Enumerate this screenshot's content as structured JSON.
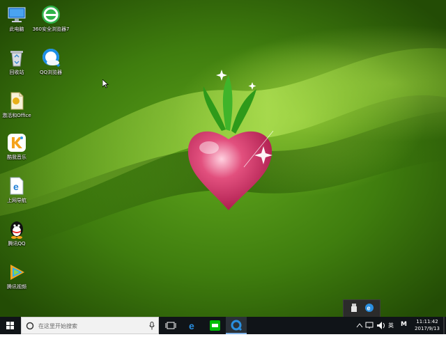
{
  "desktop_icons": [
    {
      "id": "computer",
      "label": "此电脑",
      "icon": "computer-icon"
    },
    {
      "id": "360browser",
      "label": "360安全浏览器7",
      "icon": "360-browser-icon"
    },
    {
      "id": "recycle",
      "label": "回收站",
      "icon": "recycle-bin-icon"
    },
    {
      "id": "qqbrowser",
      "label": "QQ浏览器",
      "icon": "qq-browser-icon"
    },
    {
      "id": "office",
      "label": "激活和Office",
      "icon": "office-file-icon"
    },
    {
      "id": "kuwo",
      "label": "酷我音乐",
      "icon": "kuwo-music-icon"
    },
    {
      "id": "ie",
      "label": "上网导航",
      "icon": "ie-browser-icon"
    },
    {
      "id": "qq",
      "label": "腾讯QQ",
      "icon": "qq-penguin-icon"
    },
    {
      "id": "video",
      "label": "腾讯视频",
      "icon": "tencent-video-icon"
    }
  ],
  "taskbar": {
    "search_placeholder": "在这里开始搜索",
    "lang": "英",
    "ime": "M",
    "time": "11:11:42",
    "date": "2017/9/13"
  },
  "colors": {
    "taskbar_bg": "#101418",
    "accent": "#7fb2e8",
    "desktop_green": "#4f8f15"
  }
}
